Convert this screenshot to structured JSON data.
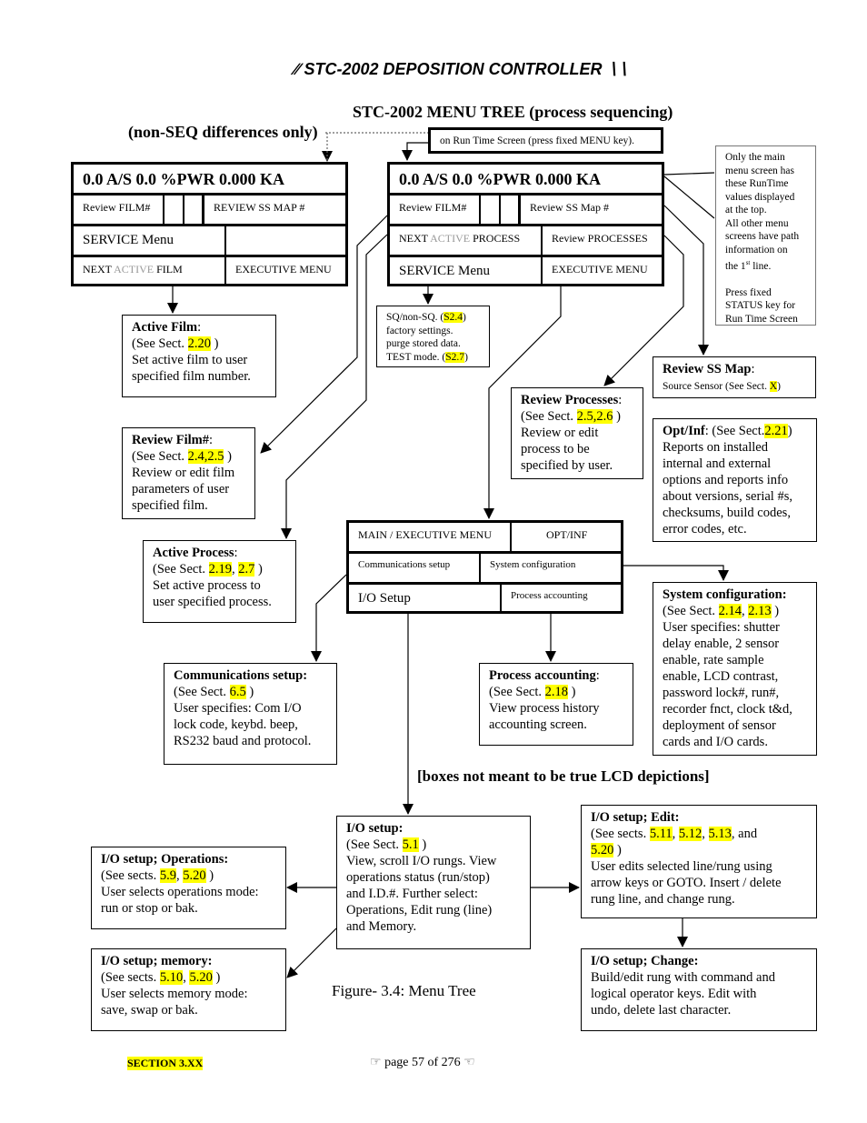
{
  "header": {
    "title": "STC-2002  DEPOSITION CONTROLLER",
    "left_icon": "hatch-left-icon",
    "right_icon": "hatch-right-icon"
  },
  "diagram_title": "STC-2002 MENU TREE (process sequencing)",
  "nonseq_label": "(non-SEQ differences only)",
  "runtime_note": "on Run Time Screen (press fixed MENU key).",
  "disclaimer": "[boxes not meant to be true LCD depictions]",
  "figure_caption": "Figure- 3.4:  Menu Tree",
  "footer": {
    "section": "SECTION 3.XX",
    "page": "page 57 of 276",
    "left_icon": "pointing-hand-right-icon",
    "right_icon": "pointing-hand-left-icon"
  },
  "lcd_left": {
    "runtime": "0.0 A/S     0.0 %PWR     0.000 KA",
    "review_film": "Review FILM#",
    "review_ss": "REVIEW SS MAP #",
    "service": "SERVICE Menu",
    "next": "NEXT ",
    "active": "ACTIVE",
    "film": " FILM",
    "exec": "EXECUTIVE MENU"
  },
  "lcd_right": {
    "runtime": "0.0 A/S     0.0 %PWR     0.000 KA",
    "review_film": "Review FILM#",
    "review_ss": "Review SS Map #",
    "next": "NEXT ",
    "active": "ACTIVE",
    "process": " PROCESS",
    "review_proc": "Review PROCESSES",
    "service": "SERVICE Menu",
    "exec": "EXECUTIVE MENU"
  },
  "main_menu": {
    "main": "MAIN / EXECUTIVE MENU",
    "optinf": "OPT/INF",
    "comm": "Communications setup",
    "sysconf": "System configuration",
    "io": "I/O Setup",
    "acct": "Process accounting"
  },
  "boxes": [
    {
      "id": "side-note",
      "lines": [
        [
          [
            "Only the main",
            ""
          ]
        ],
        [
          [
            "menu screen has",
            ""
          ]
        ],
        [
          [
            "these RunTime",
            ""
          ]
        ],
        [
          [
            "values displayed",
            ""
          ]
        ],
        [
          [
            "at the top.",
            ""
          ]
        ],
        [
          [
            "All other menu",
            ""
          ]
        ],
        [
          [
            "screens have path",
            ""
          ]
        ],
        [
          [
            "information on",
            ""
          ]
        ],
        [
          [
            "the 1",
            ""
          ],
          [
            "st",
            "sup"
          ],
          [
            " line.",
            ""
          ]
        ],
        [
          [
            "",
            ""
          ]
        ],
        [
          [
            "Press fixed",
            ""
          ]
        ],
        [
          [
            "STATUS key for",
            ""
          ]
        ],
        [
          [
            "Run Time Screen",
            ""
          ]
        ]
      ]
    },
    {
      "id": "service-options",
      "lines": [
        [
          [
            "SQ/non-SQ. (",
            ""
          ],
          [
            "S2.4",
            "h"
          ],
          [
            ")",
            ""
          ]
        ],
        [
          [
            "factory settings.",
            ""
          ]
        ],
        [
          [
            "purge stored  data.",
            ""
          ]
        ],
        [
          [
            "TEST mode. (",
            ""
          ],
          [
            "S2.7",
            "h"
          ],
          [
            ")",
            ""
          ]
        ]
      ]
    },
    {
      "id": "active-film",
      "lines": [
        [
          [
            "Active Film",
            "b"
          ],
          [
            ":",
            ""
          ]
        ],
        [
          [
            " (See Sect. ",
            ""
          ],
          [
            "2.20",
            "h"
          ],
          [
            " )",
            ""
          ]
        ],
        [
          [
            "Set active film to user",
            ""
          ]
        ],
        [
          [
            "specified film number.",
            ""
          ]
        ]
      ]
    },
    {
      "id": "review-film",
      "lines": [
        [
          [
            "Review Film#",
            "b"
          ],
          [
            ":",
            ""
          ]
        ],
        [
          [
            " (See Sect. ",
            ""
          ],
          [
            "2.4,2.5",
            "h"
          ],
          [
            " )",
            ""
          ]
        ],
        [
          [
            "Review or edit film",
            ""
          ]
        ],
        [
          [
            "parameters of user",
            ""
          ]
        ],
        [
          [
            "specified film.",
            ""
          ]
        ]
      ]
    },
    {
      "id": "review-processes",
      "lines": [
        [
          [
            "Review Processes",
            "b"
          ],
          [
            ":",
            ""
          ]
        ],
        [
          [
            " (See Sect. ",
            ""
          ],
          [
            "2.5,2.6",
            "h"
          ],
          [
            " )",
            ""
          ]
        ],
        [
          [
            "Review or edit",
            ""
          ]
        ],
        [
          [
            "process to be",
            ""
          ]
        ],
        [
          [
            "specified by user.",
            ""
          ]
        ]
      ]
    },
    {
      "id": "review-ss-map",
      "lines": [
        [
          [
            "Review SS Map",
            "b"
          ],
          [
            ":",
            ""
          ]
        ],
        [
          [
            "Source Sensor (See Sect. ",
            "s"
          ],
          [
            "X",
            "hs"
          ],
          [
            ")",
            "s"
          ]
        ]
      ]
    },
    {
      "id": "opt-inf",
      "lines": [
        [
          [
            "Opt/Inf",
            "b"
          ],
          [
            ": (See Sect.",
            ""
          ],
          [
            "2.21",
            "h"
          ],
          [
            ")",
            ""
          ]
        ],
        [
          [
            "Reports on installed",
            ""
          ]
        ],
        [
          [
            "internal and external",
            ""
          ]
        ],
        [
          [
            "options and reports info",
            ""
          ]
        ],
        [
          [
            "about versions, serial #s,",
            ""
          ]
        ],
        [
          [
            "checksums, build codes,",
            ""
          ]
        ],
        [
          [
            "error codes, etc.",
            ""
          ]
        ]
      ]
    },
    {
      "id": "active-process",
      "lines": [
        [
          [
            "Active Process",
            "b"
          ],
          [
            ":",
            ""
          ]
        ],
        [
          [
            " (See Sect. ",
            ""
          ],
          [
            "2.19",
            "h"
          ],
          [
            ", ",
            ""
          ],
          [
            "2.7",
            "h"
          ],
          [
            " )",
            ""
          ]
        ],
        [
          [
            "Set active process to",
            ""
          ]
        ],
        [
          [
            "user specified process.",
            ""
          ]
        ]
      ]
    },
    {
      "id": "system-configuration",
      "lines": [
        [
          [
            "System configuration:",
            "b"
          ]
        ],
        [
          [
            " (See Sect. ",
            ""
          ],
          [
            "2.14",
            "h"
          ],
          [
            ", ",
            ""
          ],
          [
            "2.13",
            "h"
          ],
          [
            " )",
            ""
          ]
        ],
        [
          [
            "User specifies: shutter",
            ""
          ]
        ],
        [
          [
            "delay enable, 2 sensor",
            ""
          ]
        ],
        [
          [
            "enable, rate sample",
            ""
          ]
        ],
        [
          [
            "enable, LCD contrast,",
            ""
          ]
        ],
        [
          [
            "password lock#, run#,",
            ""
          ]
        ],
        [
          [
            "recorder fnct, clock t&d,",
            ""
          ]
        ],
        [
          [
            "deployment of sensor",
            ""
          ]
        ],
        [
          [
            "cards and I/O cards.",
            ""
          ]
        ]
      ]
    },
    {
      "id": "communications-setup",
      "lines": [
        [
          [
            "Communications setup:",
            "b"
          ]
        ],
        [
          [
            " (See Sect. ",
            ""
          ],
          [
            "6.5",
            "h"
          ],
          [
            " )",
            ""
          ]
        ],
        [
          [
            "User specifies: Com I/O",
            ""
          ]
        ],
        [
          [
            "lock code, keybd. beep,",
            ""
          ]
        ],
        [
          [
            "RS232 baud and protocol.",
            ""
          ]
        ]
      ]
    },
    {
      "id": "process-accounting",
      "lines": [
        [
          [
            "Process accounting",
            "b"
          ],
          [
            ":",
            ""
          ]
        ],
        [
          [
            " (See Sect. ",
            ""
          ],
          [
            "2.18",
            "h"
          ],
          [
            " )",
            ""
          ]
        ],
        [
          [
            "View process history",
            ""
          ]
        ],
        [
          [
            "accounting screen.",
            ""
          ]
        ]
      ]
    },
    {
      "id": "io-setup",
      "lines": [
        [
          [
            "I/O setup:",
            "b"
          ]
        ],
        [
          [
            " (See Sect. ",
            ""
          ],
          [
            "5.1",
            "h"
          ],
          [
            " )",
            ""
          ]
        ],
        [
          [
            "View, scroll I/O rungs.  View",
            ""
          ]
        ],
        [
          [
            "operations status (run/stop)",
            ""
          ]
        ],
        [
          [
            "and I.D.#. Further select:",
            ""
          ]
        ],
        [
          [
            "Operations, Edit rung (line)",
            ""
          ]
        ],
        [
          [
            "and Memory.",
            ""
          ]
        ]
      ]
    },
    {
      "id": "io-operations",
      "lines": [
        [
          [
            "I/O setup; Operations:",
            "b"
          ]
        ],
        [
          [
            " (See sects. ",
            ""
          ],
          [
            "5.9",
            "h"
          ],
          [
            ", ",
            ""
          ],
          [
            "5.20",
            "h"
          ],
          [
            " )",
            ""
          ]
        ],
        [
          [
            "User selects operations mode:",
            ""
          ]
        ],
        [
          [
            "run or stop or bak.",
            ""
          ]
        ]
      ]
    },
    {
      "id": "io-edit",
      "lines": [
        [
          [
            "I/O setup; Edit:",
            "b"
          ]
        ],
        [
          [
            " (See sects. ",
            ""
          ],
          [
            "5.11",
            "h"
          ],
          [
            ", ",
            ""
          ],
          [
            "5.12",
            "h"
          ],
          [
            ", ",
            ""
          ],
          [
            "5.13",
            "h"
          ],
          [
            ", and",
            ""
          ]
        ],
        [
          [
            " ",
            ""
          ],
          [
            "5.20",
            "h"
          ],
          [
            " )",
            ""
          ]
        ],
        [
          [
            "User edits selected line/rung using",
            ""
          ]
        ],
        [
          [
            "arrow keys or GOTO. Insert / delete",
            ""
          ]
        ],
        [
          [
            "rung line, and change rung.",
            ""
          ]
        ]
      ]
    },
    {
      "id": "io-memory",
      "lines": [
        [
          [
            "I/O setup; memory:",
            "b"
          ]
        ],
        [
          [
            " (See sects. ",
            ""
          ],
          [
            "5.10",
            "h"
          ],
          [
            ", ",
            ""
          ],
          [
            "5.20",
            "h"
          ],
          [
            " )",
            ""
          ]
        ],
        [
          [
            "User selects memory mode:",
            ""
          ]
        ],
        [
          [
            "save, swap or bak.",
            ""
          ]
        ]
      ]
    },
    {
      "id": "io-change",
      "lines": [
        [
          [
            "I/O setup; Change:",
            "b"
          ]
        ],
        [
          [
            " Build/edit rung with command and",
            ""
          ]
        ],
        [
          [
            "logical operator keys. Edit with",
            ""
          ]
        ],
        [
          [
            "undo, delete last character.",
            ""
          ]
        ]
      ]
    }
  ]
}
